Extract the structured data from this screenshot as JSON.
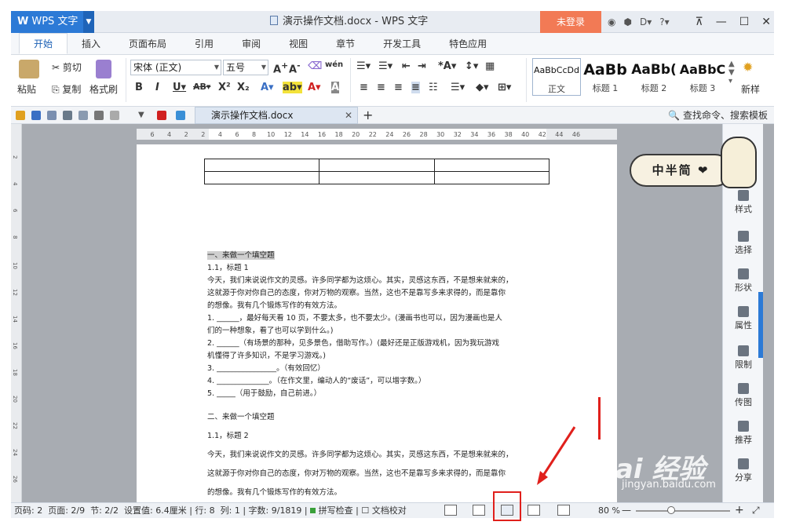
{
  "app": {
    "name": "WPS 文字",
    "window_title": "演示操作文档.docx - WPS 文字",
    "login_label": "未登录"
  },
  "tabs": [
    "开始",
    "插入",
    "页面布局",
    "引用",
    "审阅",
    "视图",
    "章节",
    "开发工具",
    "特色应用"
  ],
  "ribbon": {
    "paste": "粘贴",
    "cut": "剪切",
    "copy": "复制",
    "format_painter": "格式刷",
    "font_name": "宋体 (正文)",
    "font_size": "五号",
    "styles": [
      {
        "preview": "AaBbCcDd",
        "name": "正文"
      },
      {
        "preview": "AaBb",
        "name": "标题 1"
      },
      {
        "preview": "AaBb(",
        "name": "标题 2"
      },
      {
        "preview": "AaBbC",
        "name": "标题 3"
      }
    ],
    "new_style": "新样"
  },
  "docbar": {
    "tab_title": "演示操作文档.docx",
    "search": "查找命令、搜索模板"
  },
  "ruler_numbers": [
    "6",
    "4",
    "2",
    "2",
    "4",
    "6",
    "8",
    "10",
    "12",
    "14",
    "16",
    "18",
    "20",
    "22",
    "24",
    "26",
    "28",
    "30",
    "32",
    "34",
    "36",
    "38",
    "40",
    "42",
    "44",
    "46"
  ],
  "vruler_numbers": [
    "2",
    "4",
    "6",
    "8",
    "10",
    "12",
    "14",
    "16",
    "18",
    "20",
    "22",
    "24",
    "26"
  ],
  "document": {
    "section1_heading": "一、来做一个填空题",
    "sub1": "1.1，标题 1",
    "para1_l1": "今天，我们来说说作文的灵感。许多同学都为这烦心。其实，灵感这东西，不是想来就来的，",
    "para1_l2": "这就源于你对你自己的态度，你对万物的观察。当然，这也不是靠写多来求得的，而是靠你",
    "para1_l3": "的想像。我有几个锻炼写作的有效方法。",
    "item1_l1": "1.  ______，最好每天看 10 页，不要太多，也不要太少。(漫画书也可以，因为漫画也是人",
    "item1_l2": "们的一种想象，看了也可以学到什么。)",
    "item2_l1": "2.  ______（有场景的那种，见多景色，借助写作。）(最好还是正版游戏机，因为我玩游戏",
    "item2_l2": "机懂得了许多知识，不是学习游戏。)",
    "item3": "3.  ________________。（有效回忆）",
    "item4": "4.  ______________。（在作文里，编动人的“废话”，可以增字数。）",
    "item5": "5.  _____（用于鼓励，自己前进。）",
    "section2_heading": "二、来做一个填空题",
    "sub2": "1.1，标题 2",
    "para2_l1": "今天，我们来说说作文的灵感。许多同学都为这烦心。其实，灵感这东西，不是想来就来的，",
    "para2_l2": "这就源于你对你自己的态度，你对万物的观察。当然，这也不是靠写多来求得的，而是靠你",
    "para2_l3": "的想像。我有几个锻炼写作的有效方法。"
  },
  "sidebar": {
    "items": [
      "样式",
      "选择",
      "形状",
      "属性",
      "限制",
      "传图",
      "推荐",
      "分享"
    ]
  },
  "sticker_text": "中半简 ❤",
  "statusbar": {
    "page_code": "页码: 2",
    "page": "页面: 2/9",
    "section": "节: 2/2",
    "setting": "设置值: 6.4厘米",
    "row": "行: 8",
    "col": "列: 1",
    "chars": "字数: 9/1819",
    "spell": "拼写检查",
    "proof": "文档校对",
    "zoom": "80 %"
  },
  "watermark": {
    "brand": "Bai 经验",
    "url": "jingyan.baidu.com"
  },
  "colors": {
    "accent": "#2c7ad6",
    "login": "#f27a55",
    "annotation": "#e0201c"
  }
}
